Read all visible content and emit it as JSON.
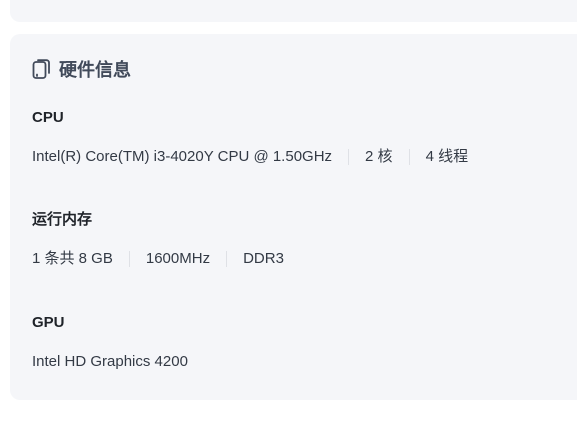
{
  "hardware": {
    "title": "硬件信息",
    "icon": "device-icon",
    "cpu": {
      "label": "CPU",
      "model": "Intel(R) Core(TM) i3-4020Y CPU @ 1.50GHz",
      "cores": "2 核",
      "threads": "4 线程"
    },
    "memory": {
      "label": "运行内存",
      "modules": "1 条共 8 GB",
      "speed": "1600MHz",
      "type": "DDR3"
    },
    "gpu": {
      "label": "GPU",
      "model": "Intel HD Graphics 4200"
    }
  },
  "colors": {
    "card_background": "#f5f6f9",
    "title_text": "#414a5a",
    "separator": "#dfe1e6"
  }
}
